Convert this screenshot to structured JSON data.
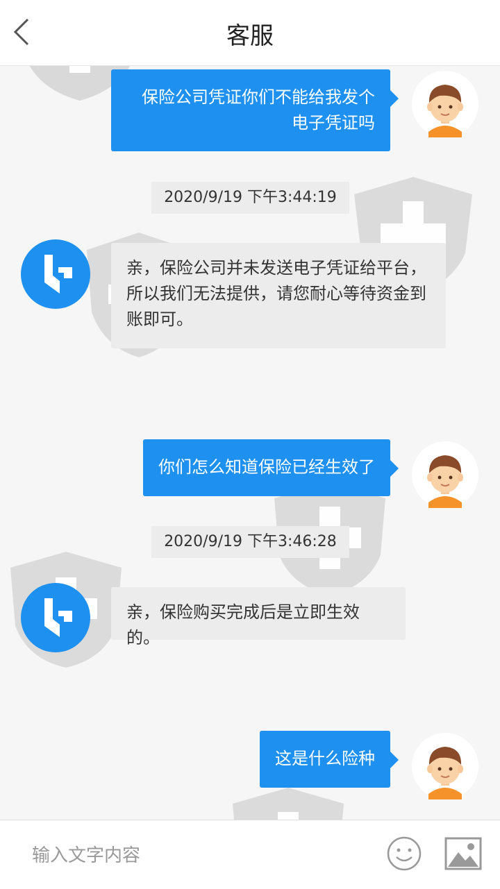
{
  "header": {
    "title": "客服"
  },
  "messages": [
    {
      "text": "保险公司凭证你们不能给我发个电子凭证吗"
    },
    {
      "timestamp": "2020/9/19 下午3:44:19"
    },
    {
      "text": "亲，保险公司并未发送电子凭证给平台，所以我们无法提供，请您耐心等待资金到账即可。"
    },
    {
      "text": "你们怎么知道保险已经生效了"
    },
    {
      "timestamp": "2020/9/19 下午3:46:28"
    },
    {
      "text": "亲，保险购买完成后是立即生效的。"
    },
    {
      "text": "这是什么险种"
    }
  ],
  "input": {
    "placeholder": "输入文字内容"
  },
  "colors": {
    "sent_bubble": "#1e90f0",
    "received_bubble": "#ececec",
    "background": "#f6f6f6"
  },
  "icons": [
    "back-arrow-icon",
    "emoji-icon",
    "image-icon"
  ]
}
